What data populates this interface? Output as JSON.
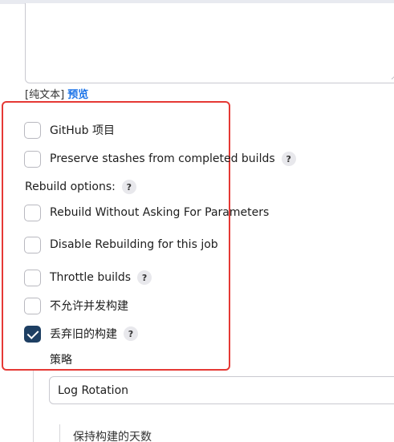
{
  "description": {
    "format_label": "[纯文本]",
    "preview_link": "预览"
  },
  "options": {
    "github_project": {
      "label": "GitHub 项目",
      "checked": false
    },
    "preserve_stashes": {
      "label": "Preserve stashes from completed builds",
      "checked": false,
      "help": "?"
    },
    "rebuild_options_label": "Rebuild options:",
    "rebuild_options_help": "?",
    "rebuild_without_asking": {
      "label": "Rebuild Without Asking For Parameters",
      "checked": false
    },
    "disable_rebuilding": {
      "label": "Disable Rebuilding for this job",
      "checked": false
    },
    "throttle_builds": {
      "label": "Throttle builds",
      "checked": false,
      "help": "?"
    },
    "no_concurrent": {
      "label": "不允许并发构建",
      "checked": false
    },
    "discard_old": {
      "label": "丢弃旧的构建",
      "checked": true,
      "help": "?"
    }
  },
  "strategy": {
    "label": "策略",
    "selected": "Log Rotation",
    "days_label": "保持构建的天数"
  },
  "colors": {
    "annotation": "#e53935",
    "checked": "#1e3f63",
    "link": "#1a73e8"
  }
}
